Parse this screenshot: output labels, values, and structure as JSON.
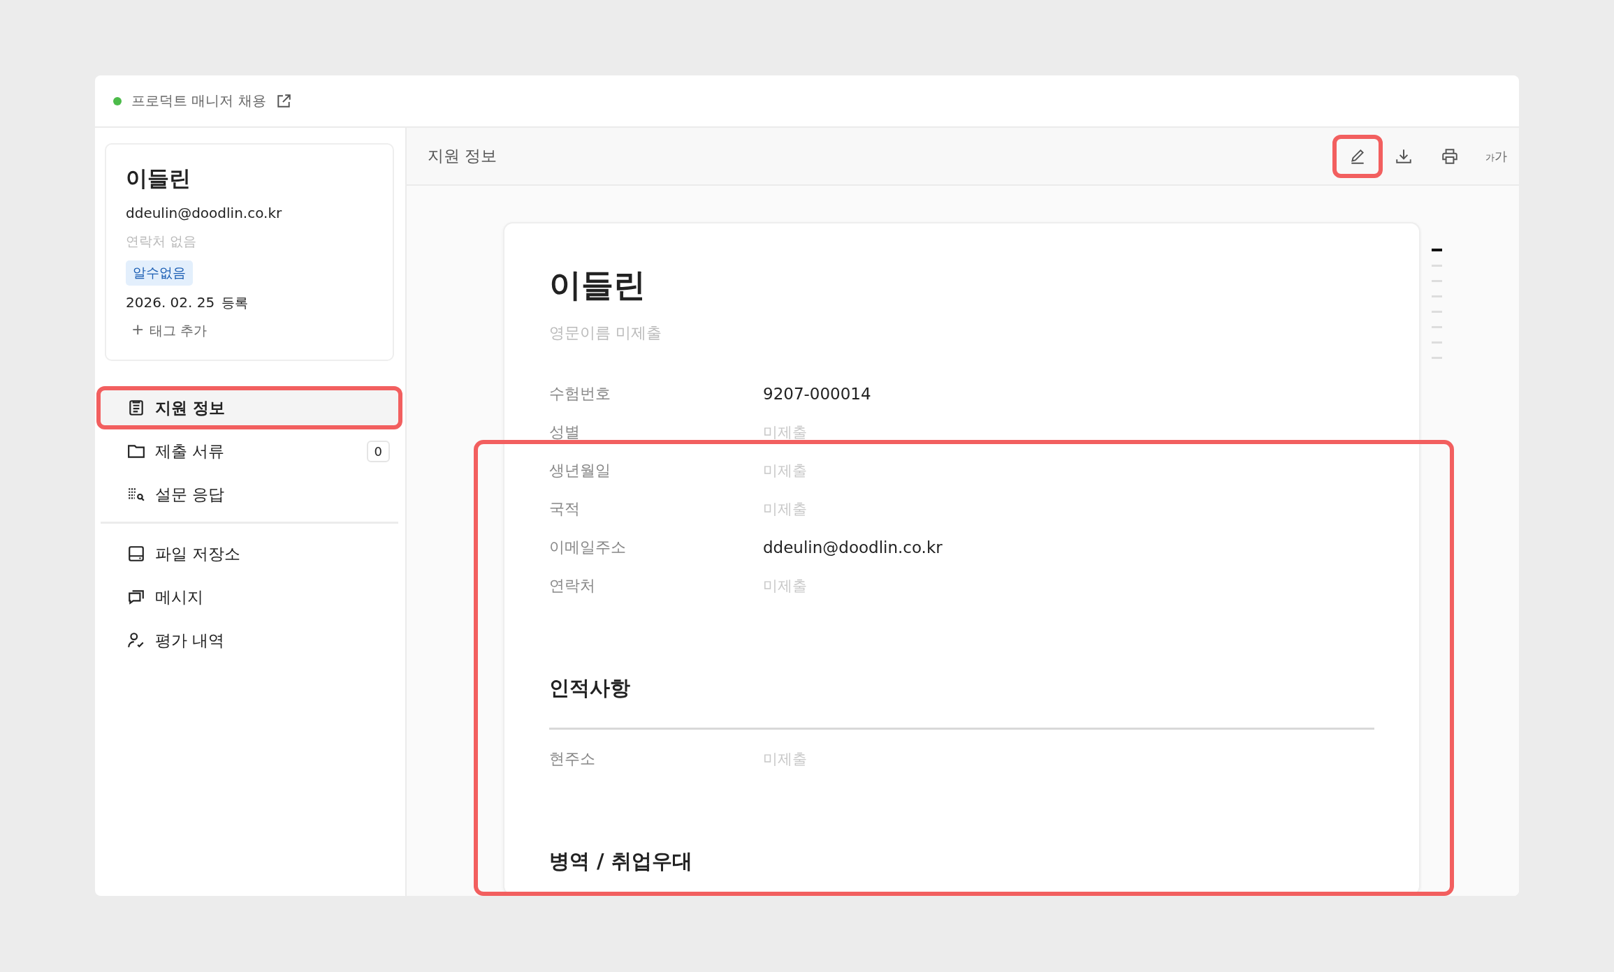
{
  "job": {
    "title": "프로덕트 매니저 채용"
  },
  "candidate": {
    "name": "이들린",
    "email": "ddeulin@doodlin.co.kr",
    "phone": "연락처 없음",
    "tag": "알수없음",
    "registered": "2026. 02. 25",
    "registered_suffix": "등록",
    "add_tag": "태그 추가",
    "add_symbol": "+"
  },
  "nav_groups": [
    [
      {
        "label": "지원 정보",
        "kind": "clipboard",
        "selected": true,
        "highlighted": true
      },
      {
        "label": "제출 서류",
        "kind": "folder",
        "selected": false,
        "highlighted": false,
        "count": "0"
      },
      {
        "label": "설문 응답",
        "kind": "survey",
        "selected": false,
        "highlighted": false
      }
    ],
    [
      {
        "label": "파일 저장소",
        "kind": "storage",
        "selected": false,
        "highlighted": false
      },
      {
        "label": "메시지",
        "kind": "chat",
        "selected": false,
        "highlighted": false
      },
      {
        "label": "평가 내역",
        "kind": "evaluate",
        "selected": false,
        "highlighted": false
      }
    ]
  ],
  "header": {
    "title": "지원 정보",
    "tools": [
      {
        "kind": "edit",
        "highlighted": true
      },
      {
        "kind": "download",
        "highlighted": false
      },
      {
        "kind": "print",
        "highlighted": false
      },
      {
        "kind": "font_size",
        "label_small": "가",
        "label_large": "가",
        "highlighted": false
      }
    ]
  },
  "document": {
    "name": "이들린",
    "english_name": "영문이름 미제출",
    "fields": [
      {
        "label": "수험번호",
        "value": "9207-000014",
        "submitted": true
      },
      {
        "label": "성별",
        "value": "미제출",
        "submitted": false
      },
      {
        "label": "생년월일",
        "value": "미제출",
        "submitted": false
      },
      {
        "label": "국적",
        "value": "미제출",
        "submitted": false
      },
      {
        "label": "이메일주소",
        "value": "ddeulin@doodlin.co.kr",
        "submitted": true
      },
      {
        "label": "연락처",
        "value": "미제출",
        "submitted": false
      }
    ],
    "sections": [
      {
        "title": "인적사항",
        "fields": [
          {
            "label": "현주소",
            "value": "미제출",
            "submitted": false
          }
        ]
      },
      {
        "title": "병역 / 취업우대"
      }
    ],
    "fields_highlighted": true
  },
  "outline_marks": [
    {
      "selected": true
    },
    {
      "selected": false
    },
    {
      "selected": false
    },
    {
      "selected": false
    },
    {
      "selected": false
    },
    {
      "selected": false
    },
    {
      "selected": false
    },
    {
      "selected": false
    }
  ]
}
